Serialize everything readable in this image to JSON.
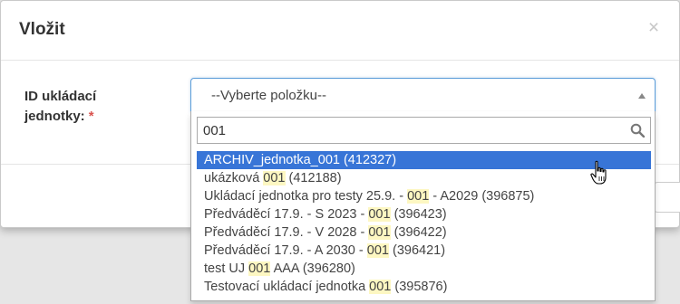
{
  "modal": {
    "title": "Vložit",
    "close_symbol": "×",
    "field_label": "ID ukládací jednotky:",
    "required_mark": "*"
  },
  "select": {
    "value": "--Vyberte položku--"
  },
  "search": {
    "value": "001",
    "icon": "search-icon"
  },
  "results": [
    {
      "pre": "ARCHIV_jednotka_",
      "match": "001",
      "post": " (412327)",
      "highlighted": true
    },
    {
      "pre": "ukázková ",
      "match": "001",
      "post": " (412188)",
      "highlighted": false
    },
    {
      "pre": "Ukládací jednotka pro testy 25.9. - ",
      "match": "001",
      "post": " - A2029 (396875)",
      "highlighted": false
    },
    {
      "pre": "Předváděcí 17.9. - S 2023 - ",
      "match": "001",
      "post": " (396423)",
      "highlighted": false
    },
    {
      "pre": "Předváděcí 17.9. - V 2028 - ",
      "match": "001",
      "post": " (396422)",
      "highlighted": false
    },
    {
      "pre": "Předváděcí 17.9. - A 2030 - ",
      "match": "001",
      "post": " (396421)",
      "highlighted": false
    },
    {
      "pre": "test UJ ",
      "match": "001",
      "post": " AAA (396280)",
      "highlighted": false
    },
    {
      "pre": "Testovací ukládací jednotka ",
      "match": "001",
      "post": " (395876)",
      "highlighted": false
    }
  ],
  "colors": {
    "highlight_bg": "#3875d7",
    "match_bg": "#fdf7c2",
    "required": "#d9534f"
  }
}
